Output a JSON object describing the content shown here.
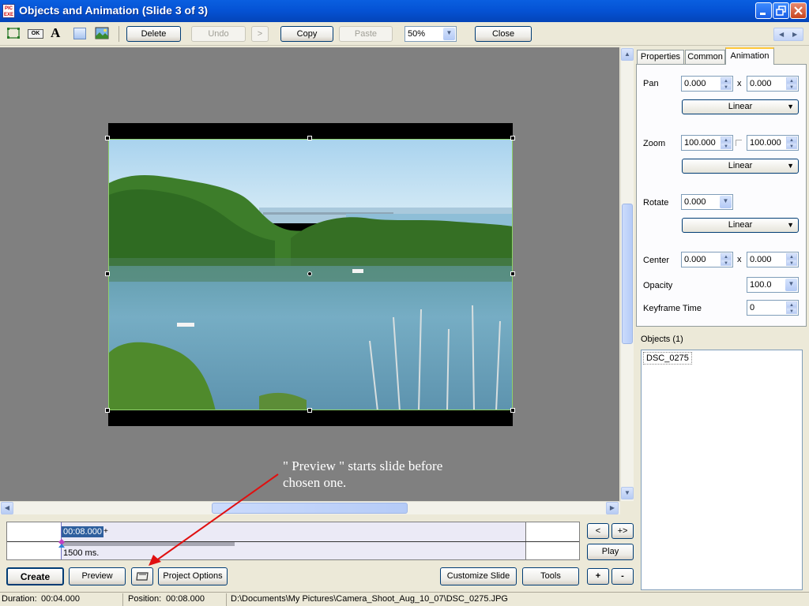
{
  "window": {
    "title": "Objects and Animation  (Slide 3 of 3)",
    "app_icon_text": "PIC EXE"
  },
  "toolbar": {
    "delete_label": "Delete",
    "undo_label": "Undo",
    "redo_label": ">",
    "copy_label": "Copy",
    "paste_label": "Paste",
    "zoom_value": "50%",
    "close_label": "Close",
    "tools": [
      {
        "icon": "frame-icon"
      },
      {
        "icon": "button-object-icon",
        "text": "OK"
      },
      {
        "icon": "text-object-icon",
        "text": "A"
      },
      {
        "icon": "rectangle-object-icon"
      },
      {
        "icon": "image-object-icon"
      }
    ]
  },
  "tabs": [
    {
      "label": "Properties",
      "active": false
    },
    {
      "label": "Common",
      "active": false
    },
    {
      "label": "Animation",
      "active": true
    }
  ],
  "animation": {
    "pan_label": "Pan",
    "pan_x": "0.000",
    "pan_y": "0.000",
    "pan_mode": "Linear",
    "zoom_label": "Zoom",
    "zoom_x": "100.000",
    "zoom_y": "100.000",
    "zoom_mode": "Linear",
    "rotate_label": "Rotate",
    "rotate_value": "0.000",
    "rotate_mode": "Linear",
    "center_label": "Center",
    "center_x": "0.000",
    "center_y": "0.000",
    "opacity_label": "Opacity",
    "opacity_value": "100.0",
    "keyframe_label": "Keyframe Time",
    "keyframe_value": "0",
    "x_sep": "x"
  },
  "objects": {
    "label": "Objects (1)",
    "items": [
      "DSC_0275"
    ]
  },
  "timeline": {
    "time": "00:08.000",
    "plus": "+",
    "duration_ms": "1500 ms."
  },
  "timeline_controls": {
    "prev_label": "<",
    "next_label": "+>",
    "play_label": "Play",
    "add_label": "+",
    "remove_label": "-"
  },
  "bottom_buttons": {
    "create_label": "Create",
    "preview_label": "Preview",
    "project_options_label": "Project Options",
    "customize_slide_label": "Customize Slide",
    "tools_label": "Tools"
  },
  "annotation": {
    "line1": "\" Preview \"  starts slide before",
    "line2": "chosen one."
  },
  "status": {
    "duration_label": "Duration:",
    "duration_value": "00:04.000",
    "position_label": "Position:",
    "position_value": "00:08.000",
    "file_path": "D:\\Documents\\My Pictures\\Camera_Shoot_Aug_10_07\\DSC_0275.JPG"
  },
  "colors": {
    "titlebar": "#0553d5",
    "canvas_bg": "#808080",
    "annotation_arrow": "#e01010",
    "selection_border": "#8fd16b"
  }
}
